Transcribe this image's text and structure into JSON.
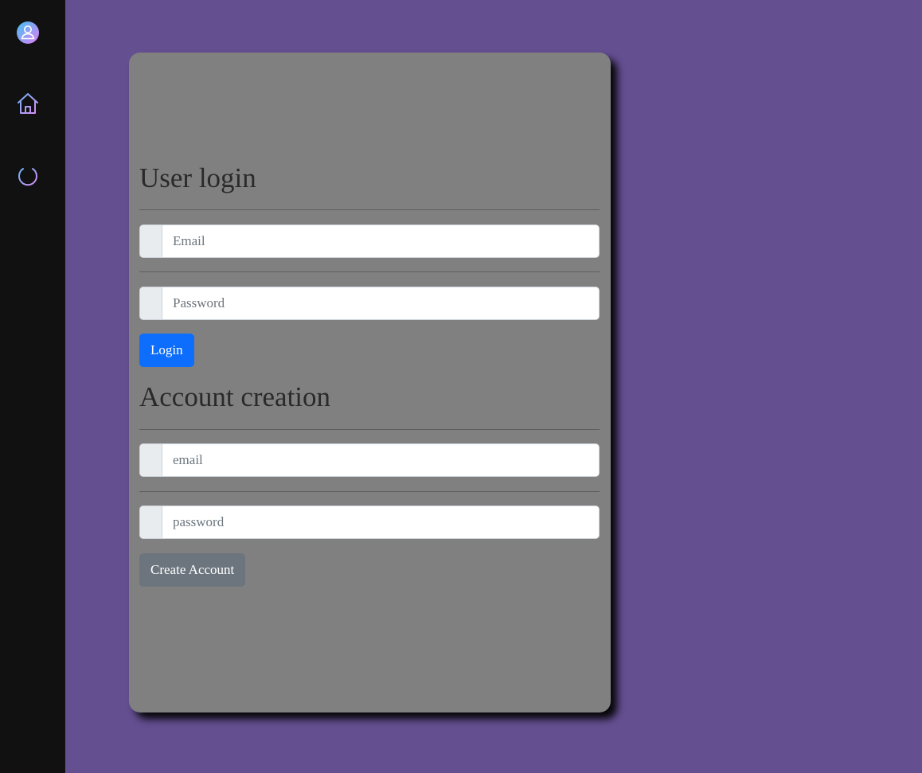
{
  "sidebar": {
    "items": [
      {
        "name": "user-icon",
        "color_start": "#3fc2f2",
        "color_end": "#e27df5"
      },
      {
        "name": "home-icon"
      },
      {
        "name": "power-icon"
      }
    ],
    "icon_colors": [
      "#6cb3f5",
      "#d88cf3"
    ]
  },
  "login": {
    "title": "User login",
    "email_placeholder": "Email",
    "password_placeholder": "Password",
    "button_label": "Login"
  },
  "signup": {
    "title": "Account creation",
    "email_placeholder": "email",
    "password_placeholder": "password",
    "button_label": "Create Account"
  },
  "colors": {
    "background": "#644f91",
    "sidebar": "#111111",
    "card": "#808080",
    "primary": "#0d6efd",
    "secondary": "#6c757d"
  }
}
